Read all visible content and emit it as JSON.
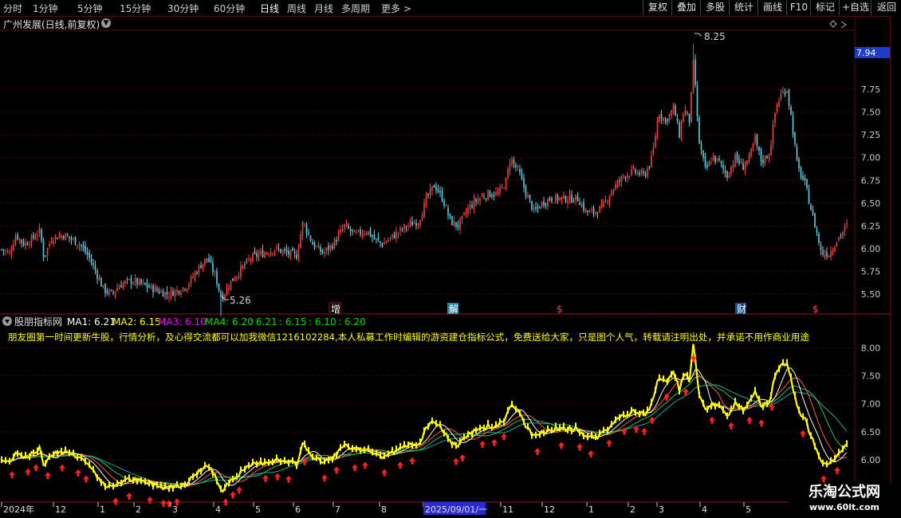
{
  "toolbar": {
    "periods": [
      "分时",
      "1分钟",
      "5分钟",
      "15分钟",
      "30分钟",
      "60分钟",
      "日线",
      "周线",
      "月线",
      "多周期",
      "更多 >"
    ],
    "active_period": "日线",
    "buttons": [
      "复权",
      "叠加",
      "多股",
      "统计",
      "画线",
      "F10",
      "标记",
      "+自选",
      "返回"
    ]
  },
  "stock": {
    "title": "广州发展(日线,前复权)"
  },
  "colors": {
    "up": "#ff3c3c",
    "down": "#56d2e6",
    "ma1": "#ffffff",
    "ma2": "#ffff00",
    "ma3": "#ff00ff",
    "ma4": "#00e000",
    "grid": "#5a1010",
    "axis": "#c8c8c8",
    "arrow": "#ff2020"
  },
  "chart_data": [
    {
      "type": "candlestick",
      "title": "广州发展(日线,前复权)",
      "ylim": [
        5.3,
        8.38
      ],
      "y_ticks": [
        5.5,
        5.75,
        6.0,
        6.25,
        6.5,
        6.75,
        7.0,
        7.25,
        7.5,
        7.75
      ],
      "current_price": "7.94",
      "annotations": {
        "high": "8.25",
        "low": "5.26"
      },
      "markers": [
        "增",
        "解",
        "$",
        "财",
        "$"
      ],
      "close_path": [
        [
          0,
          6.0
        ],
        [
          12,
          5.95
        ],
        [
          20,
          6.15
        ],
        [
          30,
          6.05
        ],
        [
          40,
          6.1
        ],
        [
          50,
          6.2
        ],
        [
          55,
          5.9
        ],
        [
          65,
          6.12
        ],
        [
          80,
          6.15
        ],
        [
          90,
          6.1
        ],
        [
          100,
          6.05
        ],
        [
          112,
          5.9
        ],
        [
          120,
          5.75
        ],
        [
          130,
          5.55
        ],
        [
          140,
          5.5
        ],
        [
          150,
          5.6
        ],
        [
          165,
          5.65
        ],
        [
          180,
          5.6
        ],
        [
          195,
          5.55
        ],
        [
          210,
          5.5
        ],
        [
          225,
          5.55
        ],
        [
          235,
          5.6
        ],
        [
          250,
          5.8
        ],
        [
          260,
          5.9
        ],
        [
          270,
          5.7
        ],
        [
          278,
          5.45
        ],
        [
          288,
          5.62
        ],
        [
          300,
          5.75
        ],
        [
          315,
          5.9
        ],
        [
          330,
          5.95
        ],
        [
          345,
          6.0
        ],
        [
          360,
          5.95
        ],
        [
          372,
          5.92
        ],
        [
          380,
          6.3
        ],
        [
          392,
          6.05
        ],
        [
          405,
          5.95
        ],
        [
          418,
          6.05
        ],
        [
          432,
          6.25
        ],
        [
          445,
          6.15
        ],
        [
          460,
          6.2
        ],
        [
          470,
          6.1
        ],
        [
          480,
          6.05
        ],
        [
          495,
          6.15
        ],
        [
          510,
          6.25
        ],
        [
          525,
          6.3
        ],
        [
          535,
          6.55
        ],
        [
          545,
          6.7
        ],
        [
          555,
          6.55
        ],
        [
          565,
          6.3
        ],
        [
          575,
          6.25
        ],
        [
          588,
          6.45
        ],
        [
          600,
          6.55
        ],
        [
          612,
          6.6
        ],
        [
          625,
          6.6
        ],
        [
          635,
          6.75
        ],
        [
          640,
          7.0
        ],
        [
          650,
          6.85
        ],
        [
          660,
          6.6
        ],
        [
          670,
          6.4
        ],
        [
          680,
          6.5
        ],
        [
          690,
          6.55
        ],
        [
          700,
          6.55
        ],
        [
          712,
          6.55
        ],
        [
          725,
          6.55
        ],
        [
          735,
          6.4
        ],
        [
          745,
          6.4
        ],
        [
          755,
          6.45
        ],
        [
          768,
          6.65
        ],
        [
          782,
          6.8
        ],
        [
          795,
          6.85
        ],
        [
          808,
          6.8
        ],
        [
          818,
          7.0
        ],
        [
          826,
          7.5
        ],
        [
          835,
          7.4
        ],
        [
          845,
          7.55
        ],
        [
          852,
          7.25
        ],
        [
          858,
          7.55
        ],
        [
          865,
          7.4
        ],
        [
          870,
          8.1
        ],
        [
          876,
          7.2
        ],
        [
          885,
          6.85
        ],
        [
          893,
          7.0
        ],
        [
          902,
          6.95
        ],
        [
          912,
          6.8
        ],
        [
          922,
          7.0
        ],
        [
          932,
          6.9
        ],
        [
          940,
          7.0
        ],
        [
          947,
          7.2
        ],
        [
          955,
          6.95
        ],
        [
          965,
          7.05
        ],
        [
          973,
          7.55
        ],
        [
          980,
          7.7
        ],
        [
          987,
          7.75
        ],
        [
          993,
          7.4
        ],
        [
          1000,
          6.9
        ],
        [
          1010,
          6.7
        ],
        [
          1018,
          6.4
        ],
        [
          1025,
          6.15
        ],
        [
          1030,
          5.95
        ],
        [
          1040,
          5.95
        ],
        [
          1050,
          6.1
        ],
        [
          1062,
          6.25
        ]
      ]
    },
    {
      "type": "line",
      "title": "股朋指标网",
      "series": [
        {
          "name": "MA1",
          "value": "6.21",
          "values_text": "MA1: 6.21"
        },
        {
          "name": "MA2",
          "value": "6.15",
          "values_text": "MA2: 6.15"
        },
        {
          "name": "MA3",
          "value": "6.10",
          "values_text": "MA3: 6.10"
        },
        {
          "name": "MA4",
          "value": "6.20",
          "values_text": "MA4: 6.20"
        }
      ],
      "extra_values": [
        ": 6.21",
        ": 6.15",
        ": 6.10",
        ": 6.20"
      ],
      "ad_text": "朋友圈第一时间更新牛股，行情分析，及心得交流都可以加我微信1216102284,本人私募工作时编辑的游资建仓指标公式，免费送给大家，只是图个人气，转载请注明出处，并承诺不用作商业用途",
      "ylim": [
        5.5,
        8.35
      ],
      "y_ticks": [
        "8.00",
        "7.50",
        "7.00",
        "6.50",
        "6.00"
      ],
      "arrows_x": [
        15,
        35,
        45,
        60,
        78,
        98,
        108,
        145,
        162,
        188,
        205,
        212,
        222,
        283,
        292,
        300,
        333,
        348,
        362,
        382,
        407,
        422,
        445,
        458,
        482,
        502,
        517,
        572,
        580,
        605,
        620,
        632,
        674,
        704,
        727,
        741,
        764,
        783,
        798,
        808,
        818,
        836,
        860,
        870,
        893,
        917,
        940,
        955,
        968,
        1007,
        1033,
        1050
      ]
    }
  ],
  "x_axis": {
    "labels": [
      "2024年",
      "12",
      "1",
      "2",
      "3",
      "4",
      "5",
      "6",
      "7",
      "8",
      "2025/09/01/一",
      "11",
      "12",
      "1",
      "2",
      "3",
      "4",
      "5"
    ],
    "highlight": "2025/09/01/一"
  },
  "watermark": {
    "line1": "乐淘公式网",
    "line2": "www.60lt.com"
  }
}
